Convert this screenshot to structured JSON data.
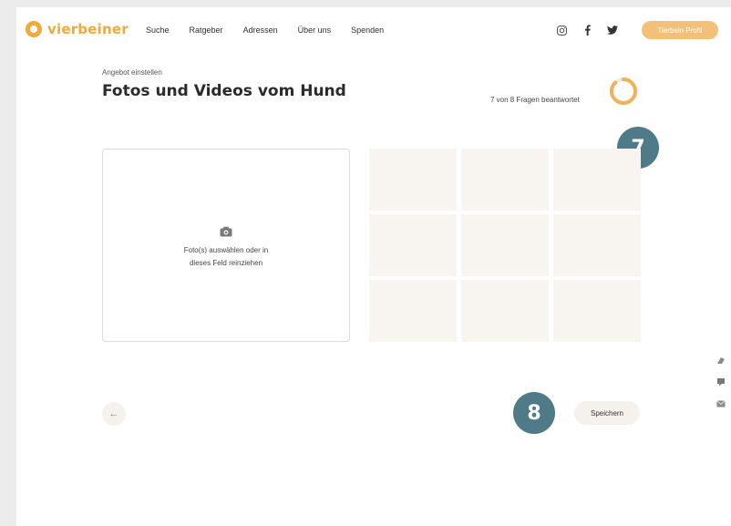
{
  "brand": {
    "name": "vierbeiner",
    "accent": "#f0a93a"
  },
  "nav": [
    {
      "label": "Suche"
    },
    {
      "label": "Ratgeber"
    },
    {
      "label": "Adressen"
    },
    {
      "label": "Über uns"
    },
    {
      "label": "Spenden"
    }
  ],
  "social": [
    {
      "icon": "instagram-icon"
    },
    {
      "icon": "facebook-icon"
    },
    {
      "icon": "twitter-icon"
    }
  ],
  "profile_button": "Tierbein Profil",
  "header": {
    "eyebrow": "Angebot einstellen",
    "title": "Fotos und Videos vom Hund"
  },
  "progress": {
    "text": "7 von 8 Fragen beantwortet",
    "answered": 7,
    "total": 8
  },
  "markers": {
    "first": "7",
    "second": "8"
  },
  "upload": {
    "icon": "camera-icon",
    "hint_line1": "Foto(s) auswählen oder in",
    "hint_line2": "dieses Feld reinziehen"
  },
  "grid": {
    "slots": 9
  },
  "actions": {
    "back_icon": "arrow-left-icon",
    "back_glyph": "←",
    "save_label": "Speichern"
  },
  "side_tabs": [
    {
      "icon": "paw-icon"
    },
    {
      "icon": "feedback-icon"
    },
    {
      "icon": "mail-icon"
    }
  ]
}
